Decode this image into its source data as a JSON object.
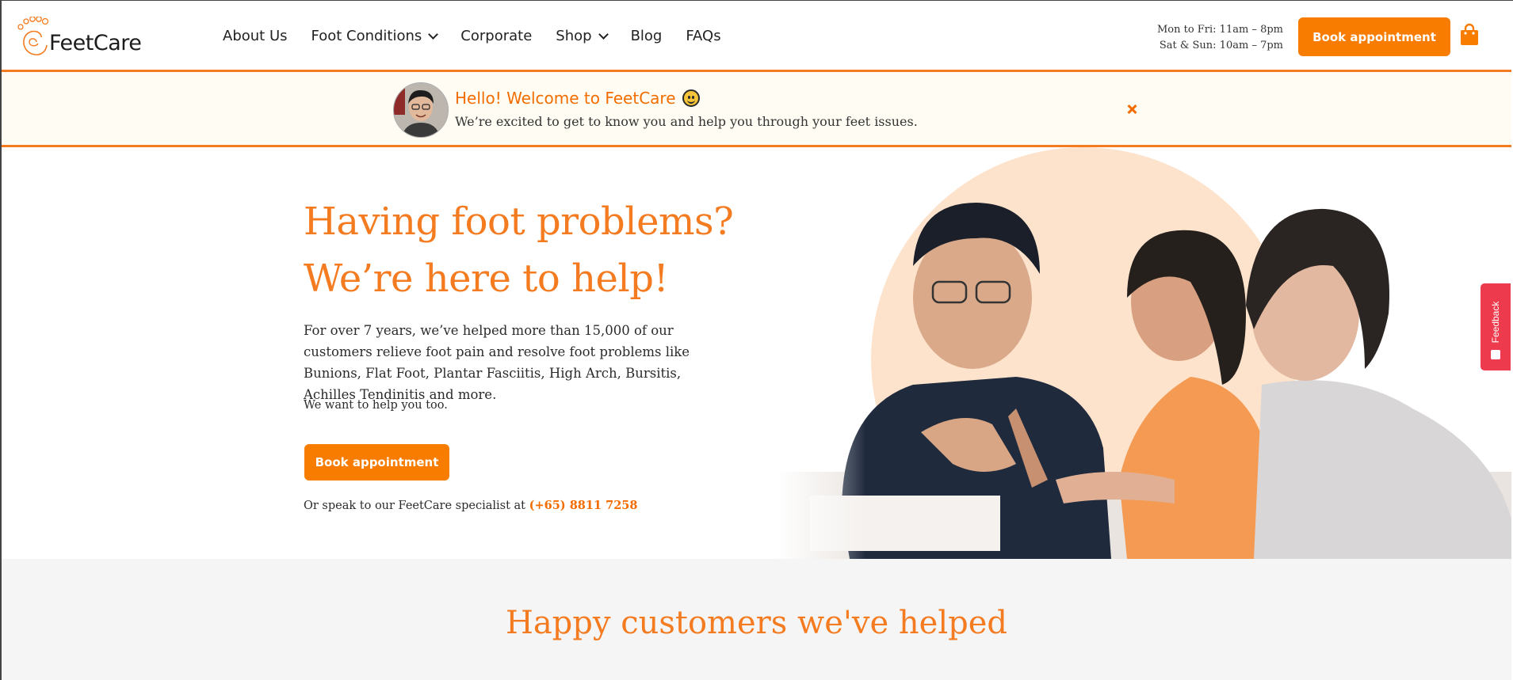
{
  "header": {
    "logo_text": "FeetCare",
    "nav": [
      {
        "label": "About Us",
        "dropdown": false
      },
      {
        "label": "Foot Conditions",
        "dropdown": true
      },
      {
        "label": "Corporate",
        "dropdown": false
      },
      {
        "label": "Shop",
        "dropdown": true
      },
      {
        "label": "Blog",
        "dropdown": false
      },
      {
        "label": "FAQs",
        "dropdown": false
      }
    ],
    "hours_weekday": "Mon to Fri: 11am – 8pm",
    "hours_weekend": "Sat & Sun: 10am – 7pm",
    "book_label": "Book appointment",
    "cart_icon": "shopping-bag-icon"
  },
  "banner": {
    "title": "Hello! Welcome to FeetCare",
    "subtitle": "We’re excited to get to know you and help you through your feet issues."
  },
  "hero": {
    "heading_line1": "Having foot problems?",
    "heading_line2": "We’re here to help!",
    "lead": "For over 7 years, we’ve helped more than 15,000 of our customers relieve foot pain and resolve foot problems like Bunions, Flat Foot, Plantar Fasciitis, High Arch, Bursitis, Achilles Tendinitis and more.",
    "small": "We want to help you too.",
    "button_label": "Book appointment",
    "speak_prefix": "Or speak to our FeetCare specialist at ",
    "phone": "(+65) 8811 7258"
  },
  "feedback": {
    "label": "Feedback"
  },
  "testimonials": {
    "title": "Happy customers we've helped"
  },
  "colors": {
    "accent": "#f77c00",
    "banner_bg": "#fffdf3",
    "feedback": "#ee3a4d",
    "section_bg": "#f5f5f5"
  }
}
